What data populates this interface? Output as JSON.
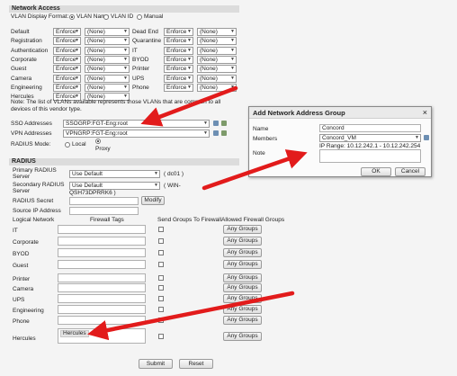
{
  "network_access": {
    "header": "Network Access",
    "vlan_format_label": "VLAN Display Format:",
    "vlan_options": [
      "VLAN Name",
      "VLAN ID",
      "Manual"
    ],
    "left_rows": [
      {
        "label": "Default",
        "mode": "Enforce",
        "value": "(None)"
      },
      {
        "label": "Registration",
        "mode": "Enforce",
        "value": "(None)"
      },
      {
        "label": "Authentication",
        "mode": "Enforce",
        "value": "(None)"
      },
      {
        "label": "Corporate",
        "mode": "Enforce",
        "value": "(None)"
      },
      {
        "label": "Guest",
        "mode": "Enforce",
        "value": "(None)"
      },
      {
        "label": "Camera",
        "mode": "Enforce",
        "value": "(None)"
      },
      {
        "label": "Engineering",
        "mode": "Enforce",
        "value": "(None)"
      },
      {
        "label": "Hercules",
        "mode": "Enforce",
        "value": "(None)"
      }
    ],
    "right_rows": [
      {
        "label": "Dead End",
        "mode": "Enforce",
        "value": "(None)"
      },
      {
        "label": "Quarantine",
        "mode": "Enforce",
        "value": "(None)"
      },
      {
        "label": "IT",
        "mode": "Enforce",
        "value": "(None)"
      },
      {
        "label": "BYOD",
        "mode": "Enforce",
        "value": "(None)"
      },
      {
        "label": "Printer",
        "mode": "Enforce",
        "value": "(None)"
      },
      {
        "label": "UPS",
        "mode": "Enforce",
        "value": "(None)"
      },
      {
        "label": "Phone",
        "mode": "Enforce",
        "value": "(None)"
      }
    ],
    "note_line1": "Note: The list of VLANs available represents those VLANs that are common to all",
    "note_line2": "devices of this vendor type.",
    "sso_label": "SSO Addresses",
    "sso_value": "SSOGRP:FGT-Eng:root",
    "vpn_label": "VPN Addresses",
    "vpn_value": "VPNGRP:FGT-Eng:root",
    "radius_mode_label": "RADIUS Mode:",
    "radius_mode_local": "Local",
    "radius_mode_proxy": "Proxy"
  },
  "radius": {
    "header": "RADIUS",
    "primary_label_1": "Primary RADIUS",
    "primary_label_2": "Server",
    "primary_value": "Use Default",
    "primary_note": "( dc01 )",
    "secondary_label_1": "Secondary RADIUS",
    "secondary_label_2": "Server",
    "secondary_value": "Use Default",
    "secondary_note_1": "( WIN-",
    "secondary_note_2": "QSH73DPRRK6 )",
    "secret_label": "RADIUS Secret",
    "modify_label": "Modify",
    "source_ip_label": "Source IP Address"
  },
  "groups_table": {
    "col_logical": "Logical Network",
    "col_tags": "Firewall Tags",
    "col_send": "Send Groups To Firewall",
    "col_allowed": "Allowed Firewall Groups",
    "any_groups_label": "Any Groups",
    "rows": [
      {
        "name": "IT",
        "tag": ""
      },
      {
        "name": "Corporate",
        "tag": ""
      },
      {
        "name": "BYOD",
        "tag": ""
      },
      {
        "name": "Guest",
        "tag": ""
      },
      {
        "name": "Printer",
        "tag": ""
      },
      {
        "name": "Camera",
        "tag": ""
      },
      {
        "name": "UPS",
        "tag": ""
      },
      {
        "name": "Engineering",
        "tag": ""
      },
      {
        "name": "Phone",
        "tag": ""
      },
      {
        "name": "Hercules",
        "tag": "Hercules"
      }
    ]
  },
  "footer": {
    "submit": "Submit",
    "reset": "Reset"
  },
  "dialog": {
    "title": "Add Network Address Group",
    "close": "×",
    "name_label": "Name",
    "name_value": "Concord",
    "members_label": "Members",
    "members_value": "Concord_VM",
    "ip_range": "IP Range: 10.12.242.1 - 10.12.242.254",
    "note_label": "Note",
    "ok": "OK",
    "cancel": "Cancel"
  },
  "colors": {
    "arrow": "#e21b1b",
    "folder_icon": "#6d8fb3",
    "edit_icon": "#7d9a6a"
  }
}
